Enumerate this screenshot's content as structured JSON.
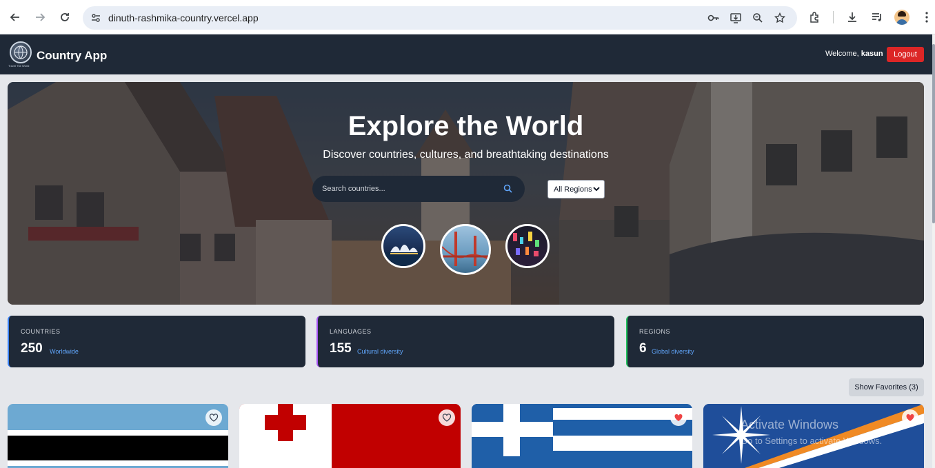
{
  "browser": {
    "url": "dinuth-rashmika-country.vercel.app"
  },
  "header": {
    "logo_caption": "Travel The World",
    "title": "Country App",
    "welcome_prefix": "Welcome,",
    "username": "kasun",
    "logout_label": "Logout"
  },
  "hero": {
    "title": "Explore the World",
    "subtitle": "Discover countries, cultures, and breathtaking destinations",
    "search_placeholder": "Search countries...",
    "region_selected": "All Regions"
  },
  "stats": [
    {
      "label": "COUNTRIES",
      "value": "250",
      "sub": "Worldwide",
      "accent": "#3b82f6"
    },
    {
      "label": "LANGUAGES",
      "value": "155",
      "sub": "Cultural diversity",
      "accent": "#a855f7"
    },
    {
      "label": "REGIONS",
      "value": "6",
      "sub": "Global diversity",
      "accent": "#22c55e"
    }
  ],
  "favorites_label": "Show Favorites (3)",
  "cards": [
    {
      "country_flag": "botswana-flag",
      "favorited": false
    },
    {
      "country_flag": "tonga-flag",
      "favorited": false
    },
    {
      "country_flag": "greece-flag",
      "favorited": true
    },
    {
      "country_flag": "marshall-islands-flag",
      "favorited": true
    }
  ],
  "watermark": {
    "title": "Activate Windows",
    "subtitle": "Go to Settings to activate Windows."
  },
  "colors": {
    "header_bg": "#1f2937",
    "logout_bg": "#dc2626",
    "link": "#60a5fa",
    "heart_filled": "#ef4444"
  }
}
